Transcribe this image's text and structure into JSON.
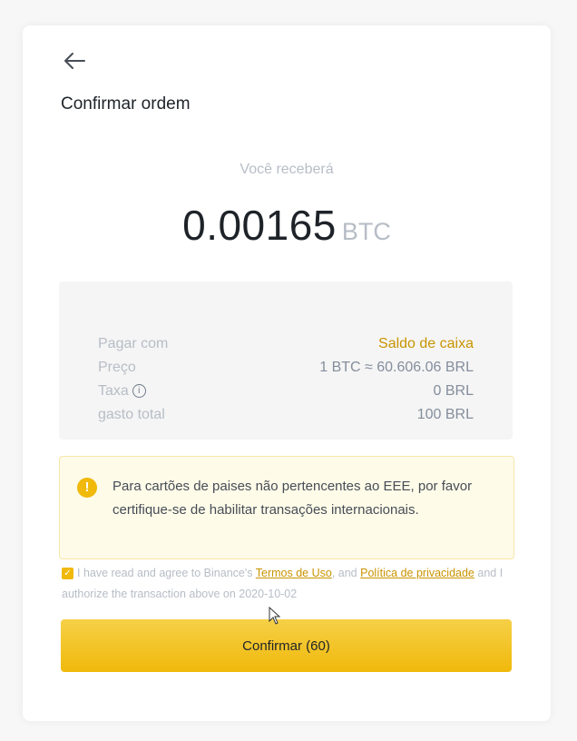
{
  "header": {
    "title": "Confirmar ordem"
  },
  "receive": {
    "label": "Você receberá",
    "amount": "0.00165",
    "unit": "BTC"
  },
  "details": [
    {
      "label": "Pagar com",
      "value": "Saldo de caixa"
    },
    {
      "label": "Preço",
      "value": "1 BTC ≈ 60.606.06 BRL"
    },
    {
      "label": "Taxa",
      "value": "0 BRL"
    },
    {
      "label": "gasto total",
      "value": "100 BRL"
    }
  ],
  "warning": {
    "text": "Para cartões de paises não pertencentes ao EEE, por favor certifique-se de habilitar transações internacionais."
  },
  "agreement": {
    "text_before": "I have read and agree to Binance's",
    "terms_link": "Termos de Uso",
    "and": ", and",
    "privacy_link": "Política de privacidade",
    "text_after": "and I authorize the transaction above on 2020-10-02"
  },
  "confirm_button": {
    "label": "Confirmar (60)"
  },
  "colors": {
    "accent": "#f0b90b",
    "link": "#c99400",
    "warning_bg": "#fefbe8"
  }
}
